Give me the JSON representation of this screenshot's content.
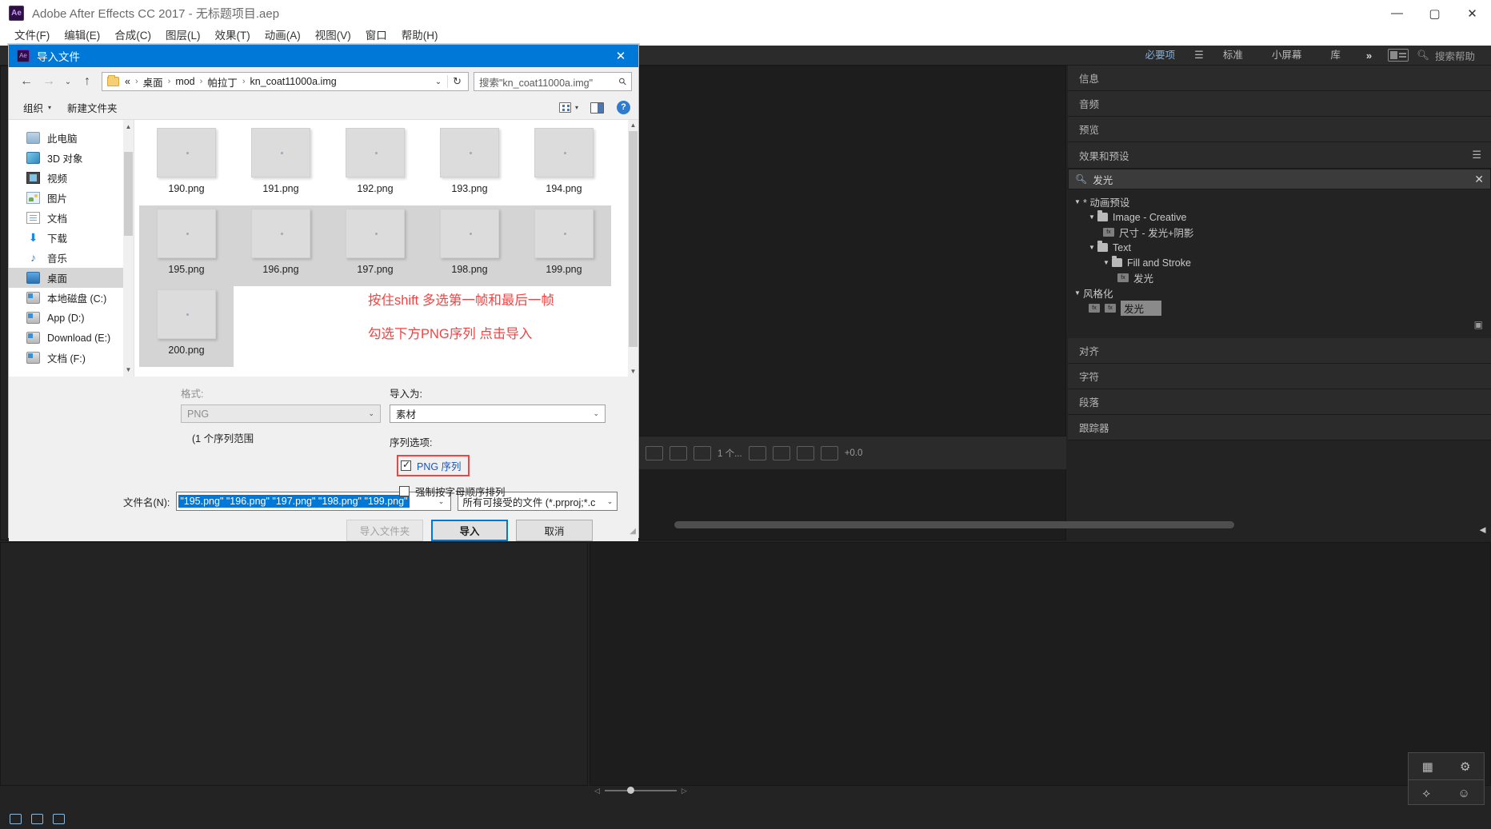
{
  "app": {
    "title": "Adobe After Effects CC 2017 - 无标题项目.aep",
    "logo_text": "Ae",
    "window_buttons": {
      "minimize": "—",
      "maximize": "▢",
      "close": "✕"
    },
    "menus": [
      "文件(F)",
      "编辑(E)",
      "合成(C)",
      "图层(L)",
      "效果(T)",
      "动画(A)",
      "视图(V)",
      "窗口",
      "帮助(H)"
    ],
    "workspace": {
      "items": [
        "必要项",
        "标准",
        "小屏幕",
        "库"
      ],
      "active": "必要项",
      "chevron": "»",
      "search_placeholder": "搜索帮助",
      "search_icon": "search-icon"
    }
  },
  "right_panel": {
    "rows": [
      "信息",
      "音频",
      "预览"
    ],
    "effects_title": "效果和预设",
    "effects_search_value": "发光",
    "effects_clear": "✕",
    "tree": [
      {
        "indent": 1,
        "arrow": "▼",
        "icon": "none",
        "label": "* 动画预设"
      },
      {
        "indent": 2,
        "arrow": "▼",
        "icon": "folder",
        "label": "Image - Creative"
      },
      {
        "indent": 3,
        "arrow": "",
        "icon": "effect",
        "label": "尺寸 - 发光+阴影"
      },
      {
        "indent": 2,
        "arrow": "▼",
        "icon": "folder",
        "label": "Text"
      },
      {
        "indent": 3,
        "arrow": "▼",
        "icon": "folder",
        "label": "Fill and Stroke"
      },
      {
        "indent": 4,
        "arrow": "",
        "icon": "effect",
        "label": "发光"
      },
      {
        "indent": 1,
        "arrow": "▼",
        "icon": "none",
        "label": "风格化"
      },
      {
        "indent": 2,
        "arrow": "",
        "icon": "effect2",
        "label": "发光",
        "selected": true
      }
    ],
    "lower_rows": [
      "对齐",
      "字符",
      "段落",
      "跟踪器"
    ]
  },
  "comp_bar": {
    "value": "1 个...",
    "offset": "+0.0"
  },
  "dialog": {
    "title": "导入文件",
    "logo_text": "Ae",
    "close": "✕",
    "nav": {
      "back": "←",
      "forward": "→",
      "recent": "⌄",
      "up": "↑"
    },
    "address": {
      "prefix": "«",
      "crumbs": [
        "桌面",
        "mod",
        "帕拉丁",
        "kn_coat11000a.img"
      ],
      "separator": "›",
      "caret": "⌄",
      "refresh": "↻"
    },
    "search": {
      "placeholder": "搜索\"kn_coat11000a.img\"",
      "icon": "search-icon"
    },
    "toolbar": {
      "organize": "组织",
      "organize_caret": "▾",
      "new_folder": "新建文件夹",
      "view_caret": "▾",
      "help": "?"
    },
    "sidebar": [
      {
        "label": "此电脑",
        "icon": "pc-icon",
        "active": false
      },
      {
        "label": "3D 对象",
        "icon": "3d-object-icon",
        "active": false
      },
      {
        "label": "视频",
        "icon": "video-icon",
        "active": false
      },
      {
        "label": "图片",
        "icon": "picture-icon",
        "active": false
      },
      {
        "label": "文档",
        "icon": "document-icon",
        "active": false
      },
      {
        "label": "下载",
        "icon": "download-icon",
        "active": false
      },
      {
        "label": "音乐",
        "icon": "music-icon",
        "active": false
      },
      {
        "label": "桌面",
        "icon": "desktop-icon",
        "active": true
      },
      {
        "label": "本地磁盘 (C:)",
        "icon": "drive-icon",
        "active": false
      },
      {
        "label": "App (D:)",
        "icon": "drive-icon",
        "active": false
      },
      {
        "label": "Download (E:)",
        "icon": "drive-icon",
        "active": false
      },
      {
        "label": "文档 (F:)",
        "icon": "drive-icon",
        "active": false
      }
    ],
    "files": [
      {
        "name": "190.png",
        "selected": false
      },
      {
        "name": "191.png",
        "selected": false
      },
      {
        "name": "192.png",
        "selected": false
      },
      {
        "name": "193.png",
        "selected": false
      },
      {
        "name": "194.png",
        "selected": false
      },
      {
        "name": "195.png",
        "selected": true
      },
      {
        "name": "196.png",
        "selected": true
      },
      {
        "name": "197.png",
        "selected": true
      },
      {
        "name": "198.png",
        "selected": true
      },
      {
        "name": "199.png",
        "selected": true
      },
      {
        "name": "200.png",
        "selected": true
      }
    ],
    "annotations": [
      "按住shift 多选第一帧和最后一帧",
      "勾选下方PNG序列 点击导入"
    ],
    "annotation_color": "#ef4444",
    "options": {
      "format_label": "格式:",
      "format_value": "PNG",
      "range_note": "(1 个序列范围",
      "import_as_label": "导入为:",
      "import_as_value": "素材",
      "sequence_label": "序列选项:",
      "png_sequence_label": "PNG 序列",
      "png_sequence_checked": true,
      "force_alpha_label": "强制按字母顺序排列",
      "force_alpha_checked": false
    },
    "filename": {
      "label": "文件名(N):",
      "value": "\"195.png\" \"196.png\" \"197.png\" \"198.png\" \"199.png\"",
      "type_value": "所有可接受的文件 (*.prproj;*.c"
    },
    "buttons": {
      "import_folder": "导入文件夹",
      "import": "导入",
      "cancel": "取消"
    }
  }
}
